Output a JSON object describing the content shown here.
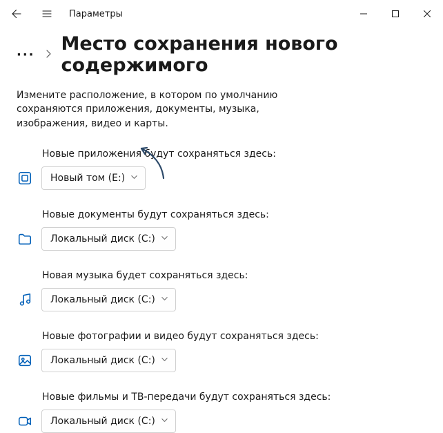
{
  "titlebar": {
    "label": "Параметры"
  },
  "breadcrumb": {
    "title": "Место сохранения нового содержимого"
  },
  "description": "Измените расположение, в котором по умолчанию сохраняются приложения, документы, музыка, изображения, видео и карты.",
  "settings": {
    "apps": {
      "label": "Новые приложения будут сохраняться здесь:",
      "value": "Новый том (E:)"
    },
    "documents": {
      "label": "Новые документы будут сохраняться здесь:",
      "value": "Локальный диск (C:)"
    },
    "music": {
      "label": "Новая музыка будет сохраняться здесь:",
      "value": "Локальный диск (C:)"
    },
    "photos": {
      "label": "Новые фотографии и видео будут сохраняться здесь:",
      "value": "Локальный диск (C:)"
    },
    "movies": {
      "label": "Новые фильмы и ТВ-передачи будут сохраняться здесь:",
      "value": "Локальный диск (C:)"
    }
  }
}
